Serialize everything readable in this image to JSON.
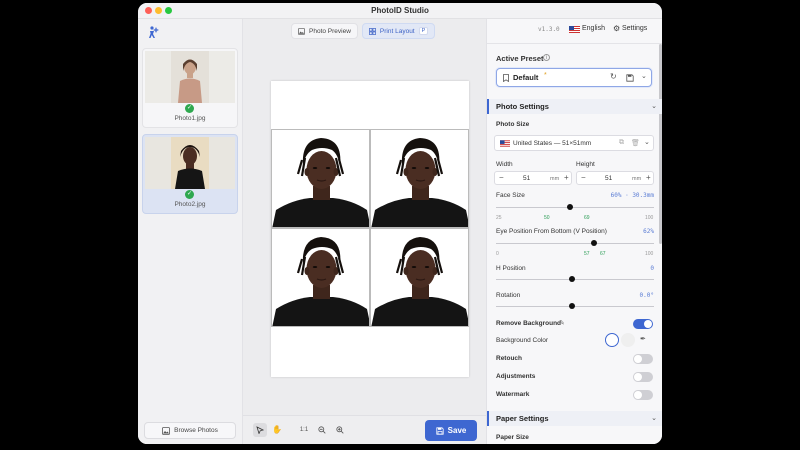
{
  "window": {
    "title": "PhotoID Studio"
  },
  "sidebar": {
    "photos": [
      {
        "name": "Photo1.jpg",
        "selected": false
      },
      {
        "name": "Photo2.jpg",
        "selected": true
      }
    ],
    "browse_label": "Browse Photos"
  },
  "tabs": [
    {
      "label": "Photo Preview",
      "active": false
    },
    {
      "label": "Print Layout",
      "active": true,
      "shortcut": "P"
    }
  ],
  "toolbar": {
    "tools": [
      "select-tool",
      "hand-tool",
      "actual-size",
      "zoom-out",
      "zoom-in"
    ],
    "actual_size_label": "1:1",
    "save_label": "Save"
  },
  "topbar": {
    "version": "v1.3.0",
    "language": "English",
    "settings_label": "Settings"
  },
  "active_preset": {
    "label": "Active Preset",
    "value": "Default",
    "modified_marker": "*"
  },
  "photo_settings": {
    "title": "Photo Settings",
    "photo_size_label": "Photo Size",
    "photo_size_value": "United States — 51×51mm",
    "width_label": "Width",
    "width_value": "51",
    "height_label": "Height",
    "height_value": "51",
    "unit": "mm",
    "face_size": {
      "label": "Face Size",
      "readout": "60% · 30.3mm",
      "min": "25",
      "max": "100",
      "marks": [
        "50",
        "69"
      ],
      "value": 60
    },
    "eye_position": {
      "label": "Eye Position From Bottom (V Position)",
      "readout": "62%",
      "min": "0",
      "max": "100",
      "marks": [
        "57",
        "67"
      ],
      "value": 62
    },
    "h_position": {
      "label": "H Position",
      "readout": "0"
    },
    "rotation": {
      "label": "Rotation",
      "readout": "0.0°"
    },
    "remove_background": {
      "label": "Remove Background",
      "on": true
    },
    "background_color": {
      "label": "Background Color",
      "swatches": [
        "#ffffff",
        "#f0f0f0"
      ]
    },
    "retouch": {
      "label": "Retouch",
      "on": false
    },
    "adjustments": {
      "label": "Adjustments",
      "on": false
    },
    "watermark": {
      "label": "Watermark",
      "on": false
    }
  },
  "paper_settings": {
    "title": "Paper Settings",
    "paper_size_label": "Paper Size"
  },
  "colors": {
    "accent": "#3e67d1",
    "success": "#2fa84f"
  }
}
